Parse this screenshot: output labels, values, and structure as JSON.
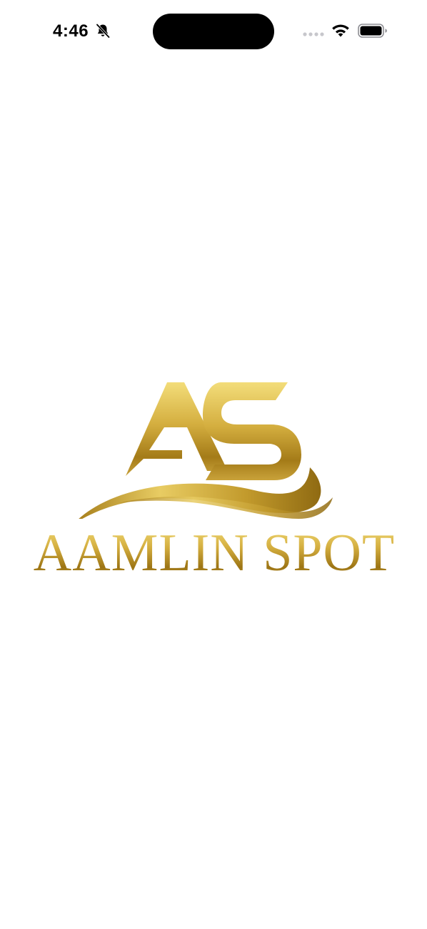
{
  "status_bar": {
    "time": "4:46",
    "icons": [
      "bell-slash-icon",
      "cellular-signal-icon",
      "wifi-icon",
      "battery-icon"
    ]
  },
  "splash": {
    "logo_monogram": "AS",
    "brand_name": "AAMLIN SPOT",
    "brand_color": "#c9a23a"
  }
}
